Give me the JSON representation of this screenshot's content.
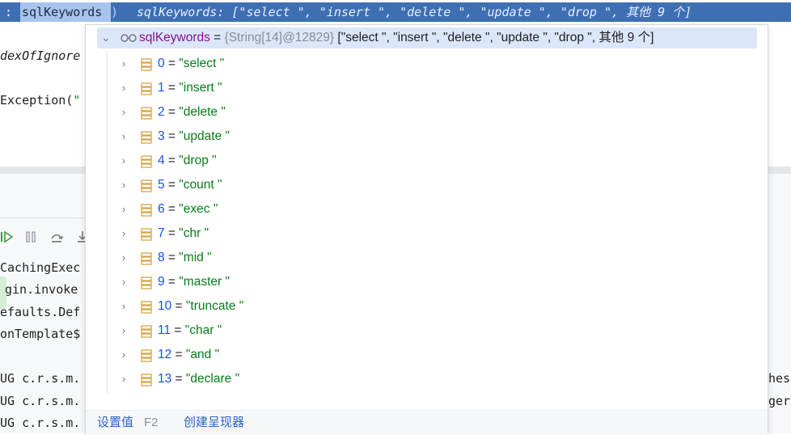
{
  "editor": {
    "top_colon": ":",
    "top_var": "sqlKeywords",
    "top_paren": ")",
    "inline_hint": "sqlKeywords: [\"select \", \"insert \", \"delete \", \"update \", \"drop \", 其他 9 个]",
    "frag_index_of": "dexOfIgnore",
    "frag_exception_word": "Exception(",
    "frag_exception_quote": "\""
  },
  "console": {
    "lines": [
      "CachingExec",
      "gin.invoke",
      "efaults.Def",
      "onTemplate$"
    ],
    "log_lines": [
      "UG c.r.s.m.",
      "UG c.r.s.m.",
      "UG c.r.s.m."
    ],
    "right_frags": [
      "hess",
      "ger"
    ],
    "toolbar_icons": [
      "resume-icon",
      "pause-icon",
      "step-over-icon",
      "step-into-icon"
    ]
  },
  "popup": {
    "root": {
      "name": "sqlKeywords",
      "eq": " = ",
      "type": "{String[14]@12829}",
      "value": " [\"select \", \"insert \", \"delete \", \"update \", \"drop \", 其他 9 个]"
    },
    "items": [
      {
        "index": "0",
        "eq": " = ",
        "value": "\"select \""
      },
      {
        "index": "1",
        "eq": " = ",
        "value": "\"insert \""
      },
      {
        "index": "2",
        "eq": " = ",
        "value": "\"delete \""
      },
      {
        "index": "3",
        "eq": " = ",
        "value": "\"update \""
      },
      {
        "index": "4",
        "eq": " = ",
        "value": "\"drop \""
      },
      {
        "index": "5",
        "eq": " = ",
        "value": "\"count \""
      },
      {
        "index": "6",
        "eq": " = ",
        "value": "\"exec \""
      },
      {
        "index": "7",
        "eq": " = ",
        "value": "\"chr \""
      },
      {
        "index": "8",
        "eq": " = ",
        "value": "\"mid \""
      },
      {
        "index": "9",
        "eq": " = ",
        "value": "\"master \""
      },
      {
        "index": "10",
        "eq": " = ",
        "value": "\"truncate \""
      },
      {
        "index": "11",
        "eq": " = ",
        "value": "\"char \""
      },
      {
        "index": "12",
        "eq": " = ",
        "value": "\"and \""
      },
      {
        "index": "13",
        "eq": " = ",
        "value": "\"declare \""
      }
    ],
    "footer": {
      "set_value": "设置值",
      "shortcut": "F2",
      "create_renderer": "创建呈现器"
    }
  },
  "colors": {
    "selection_blue": "#3f6fb3",
    "root_row_bg": "#dbe6fa",
    "string_green": "#067d17",
    "name_purple": "#871094",
    "index_blue": "#1750eb",
    "array_icon_orange": "#d6a54a"
  }
}
